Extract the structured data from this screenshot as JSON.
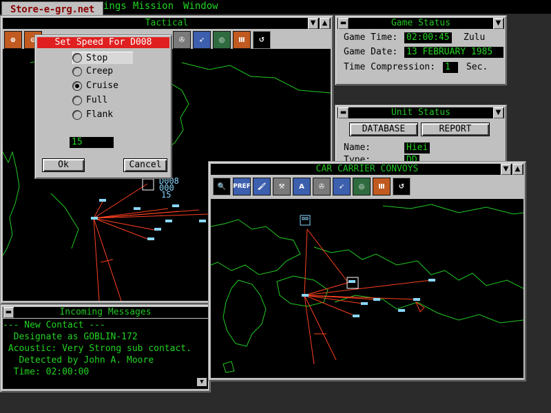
{
  "menubar": {
    "logo_text": "Store-e-grg.net",
    "items": [
      "ings",
      "Mission",
      "Window"
    ]
  },
  "tactical": {
    "title": "Tactical"
  },
  "game_status": {
    "title": "Game Status",
    "time_label": "Game Time:",
    "time_value": "02:00:45",
    "time_zone": "Zulu",
    "date_label": "Game Date:",
    "date_value": "13 FEBRUARY 1985",
    "compression_label": "Time Compression:",
    "compression_value": "1",
    "compression_unit": "Sec."
  },
  "unit_status": {
    "title": "Unit Status",
    "database_label": "DATABASE",
    "report_label": "REPORT",
    "name_label": "Name:",
    "name_value": "Hiei",
    "type_label": "Type:",
    "type_value": "DD"
  },
  "convoy": {
    "title": "CAR CARRIER CONVOYS",
    "toolbar_pref": "PREF"
  },
  "speed_dialog": {
    "title": "Set Speed For D008",
    "options": [
      "Stop",
      "Creep",
      "Cruise",
      "Full",
      "Flank"
    ],
    "selected": "Cruise",
    "speed_value": "15",
    "ok_label": "Ok",
    "cancel_label": "Cancel"
  },
  "messages": {
    "title": "Incoming Messages",
    "lines": [
      "--- New Contact ---",
      "  Designate as GOBLIN-172",
      " Acoustic: Very Strong sub contact.",
      "   Detected by John A. Moore",
      "  Time: 02:00:00"
    ]
  },
  "map_labels": {
    "tactical_unit": [
      "D008",
      "000",
      "15"
    ]
  },
  "colors": {
    "green_text": "#22d422",
    "coast": "#22cc22",
    "track": "#ff4020",
    "ship": "#8ad8ff",
    "dialog_title_bg": "#e02020",
    "dialog_title_fg": "#ffffff"
  }
}
